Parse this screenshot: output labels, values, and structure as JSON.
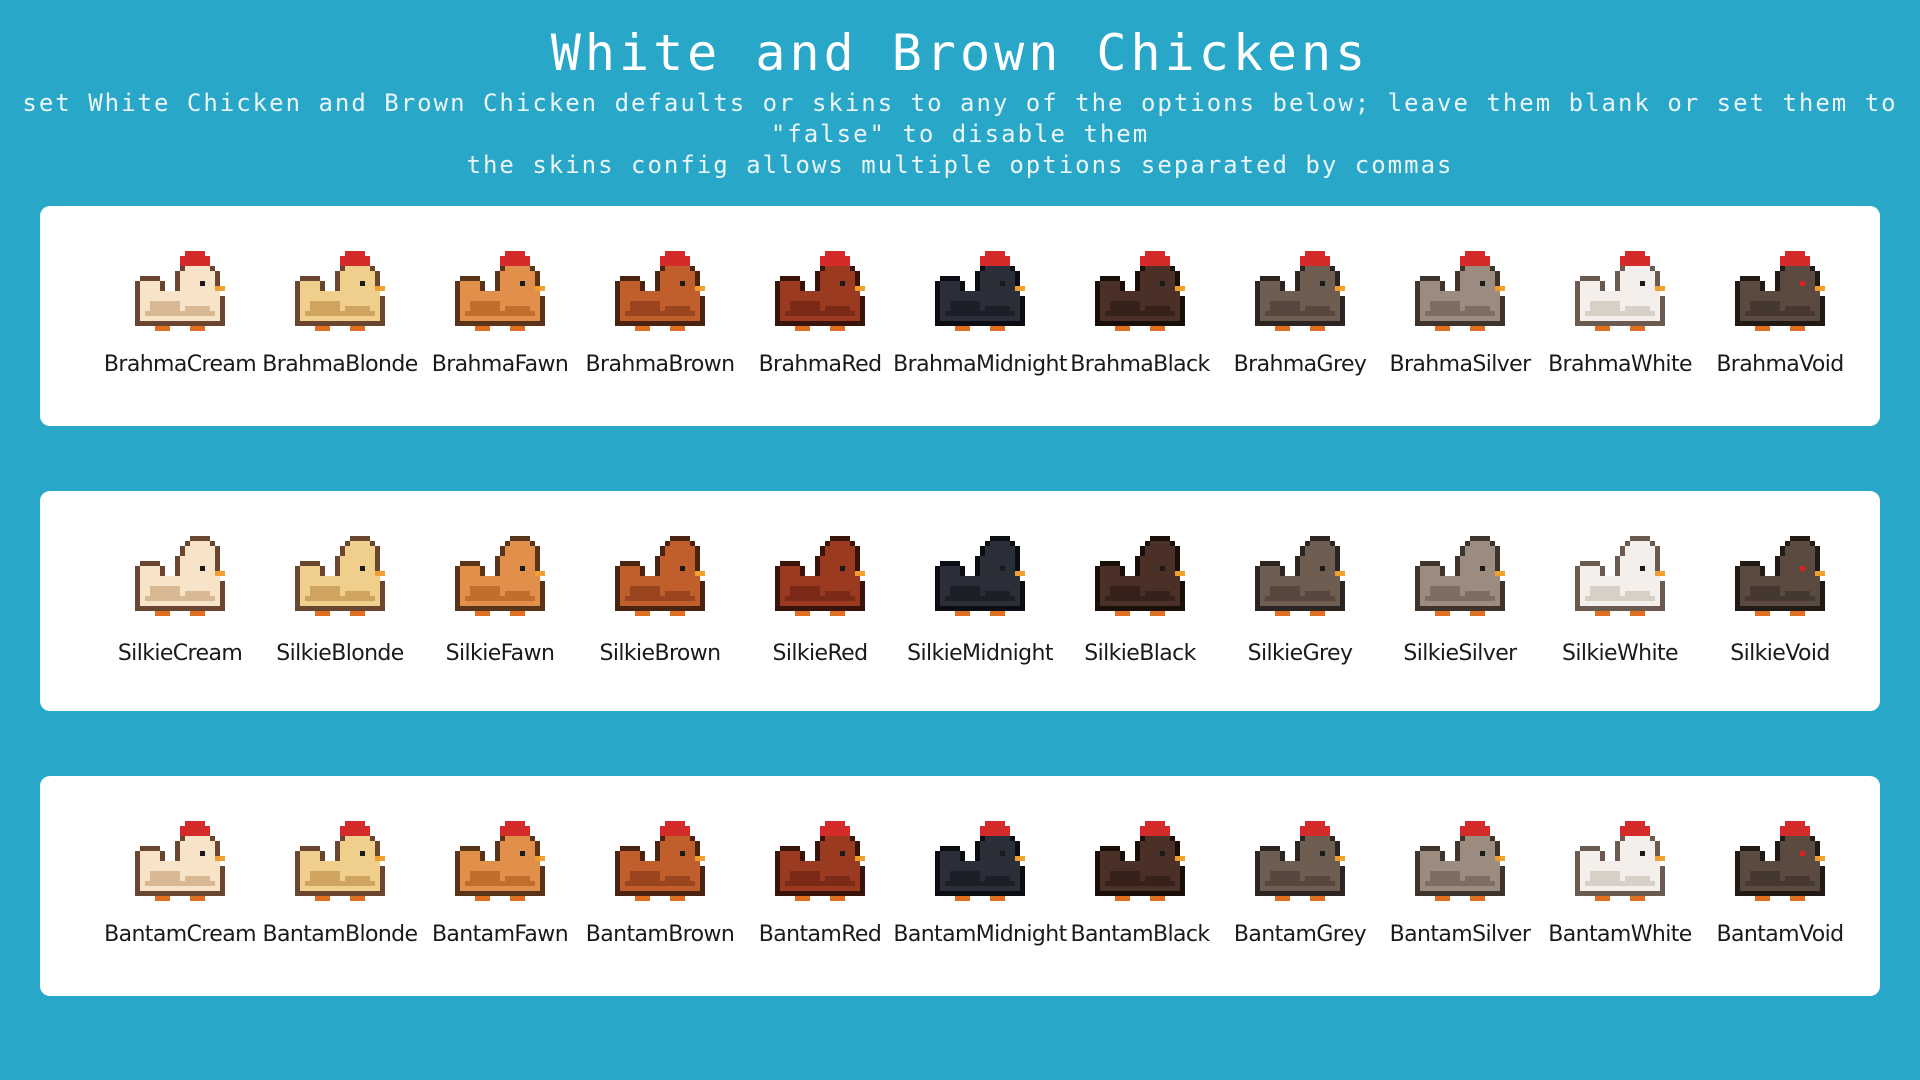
{
  "header": {
    "title": "White and Brown Chickens",
    "subtitle_line1": "set White Chicken and Brown Chicken defaults or skins to any of the options below; leave them blank or set them to \"false\" to disable them",
    "subtitle_line2": "the skins config allows multiple options separated by commas"
  },
  "colors": {
    "background": "#29a7c9",
    "panel": "#ffffff",
    "comb": "#d42a2a",
    "beak": "#f0a030",
    "feet": "#e07020"
  },
  "palettes": [
    {
      "name": "Cream",
      "body": "#f6e3c8",
      "shade": "#d9b894",
      "outline": "#6a4630"
    },
    {
      "name": "Blonde",
      "body": "#f0cf8c",
      "shade": "#cfa45e",
      "outline": "#6a4630"
    },
    {
      "name": "Fawn",
      "body": "#e0904a",
      "shade": "#c06e2e",
      "outline": "#5a3418"
    },
    {
      "name": "Brown",
      "body": "#c05e2c",
      "shade": "#9a4420",
      "outline": "#4a2410"
    },
    {
      "name": "Red",
      "body": "#9a3a20",
      "shade": "#7a2a16",
      "outline": "#3a140a"
    },
    {
      "name": "Midnight",
      "body": "#2a2e38",
      "shade": "#1c1f27",
      "outline": "#0c0d12"
    },
    {
      "name": "Black",
      "body": "#4a3026",
      "shade": "#36221a",
      "outline": "#1a0e08"
    },
    {
      "name": "Grey",
      "body": "#6e5e52",
      "shade": "#56483e",
      "outline": "#2c2420"
    },
    {
      "name": "Silver",
      "body": "#9c8c80",
      "shade": "#7e6e62",
      "outline": "#3e342c"
    },
    {
      "name": "White",
      "body": "#f4efea",
      "shade": "#d8cfc6",
      "outline": "#6a5a50"
    },
    {
      "name": "Void",
      "body": "#5a4a40",
      "shade": "#443830",
      "outline": "#221a14",
      "eye": "#e02020"
    }
  ],
  "rows": [
    {
      "breed": "Brahma",
      "items": [
        "BrahmaCream",
        "BrahmaBlonde",
        "BrahmaFawn",
        "BrahmaBrown",
        "BrahmaRed",
        "BrahmaMidnight",
        "BrahmaBlack",
        "BrahmaGrey",
        "BrahmaSilver",
        "BrahmaWhite",
        "BrahmaVoid"
      ]
    },
    {
      "breed": "Silkie",
      "items": [
        "SilkieCream",
        "SilkieBlonde",
        "SilkieFawn",
        "SilkieBrown",
        "SilkieRed",
        "SilkieMidnight",
        "SilkieBlack",
        "SilkieGrey",
        "SilkieSilver",
        "SilkieWhite",
        "SilkieVoid"
      ]
    },
    {
      "breed": "Bantam",
      "items": [
        "BantamCream",
        "BantamBlonde",
        "BantamFawn",
        "BantamBrown",
        "BantamRed",
        "BantamMidnight",
        "BantamBlack",
        "BantamGrey",
        "BantamSilver",
        "BantamWhite",
        "BantamVoid"
      ]
    }
  ]
}
